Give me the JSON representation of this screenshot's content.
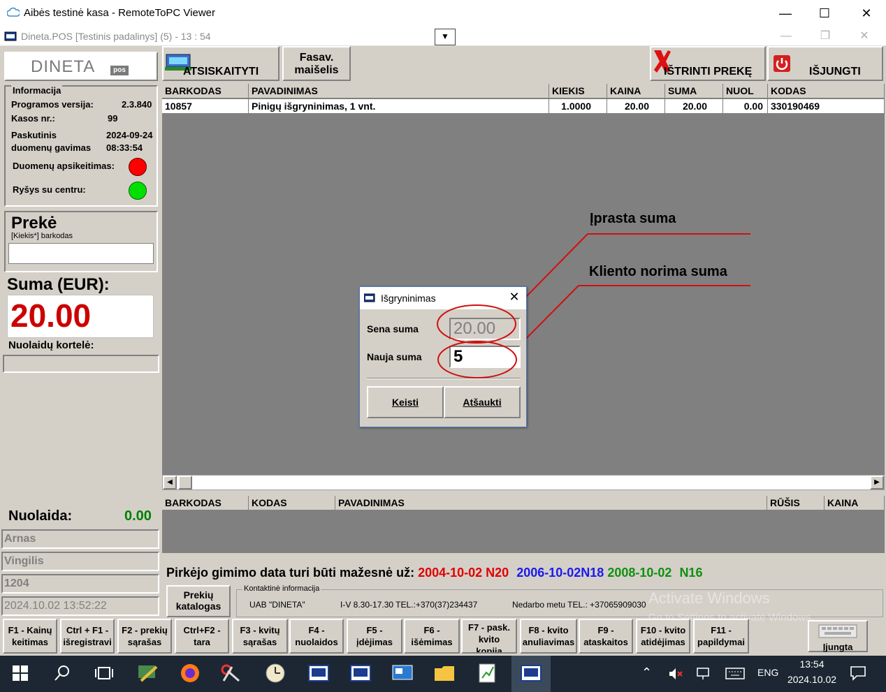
{
  "window": {
    "title": "Aibės testinė kasa - RemoteToPC Viewer"
  },
  "app": {
    "title": "Dineta.POS [Testinis padalinys] (5) - 13 : 54"
  },
  "toolbar": {
    "pay": "ATSISKAITYTI",
    "bag_line1": "Fasav.",
    "bag_line2": "maišelis",
    "delete": "IŠTRINTI PREKĘ",
    "off": "IŠJUNGTI"
  },
  "sidebar": {
    "logo": "DINETA",
    "logo_sub": "pos",
    "info_title": "Informacija",
    "version_label": "Programos versija:",
    "version_value": "2.3.840",
    "till_label": "Kasos nr.:",
    "till_value": "99",
    "last_label1": "Paskutinis",
    "last_label2": "duomenų gavimas",
    "last_date": "2024-09-24",
    "last_time": "08:33:54",
    "exchange_label": "Duomenų apsikeitimas:",
    "exchange_color": "#ff0000",
    "center_label": "Ryšys su centru:",
    "center_color": "#00e000",
    "item_title": "Prekė",
    "item_hint": "[Kiekis*] barkodas",
    "item_input": "",
    "sum_title": "Suma (EUR):",
    "sum_value": "20.00",
    "card_label": "Nuolaidų kortelė:",
    "card_value": "",
    "discount_label": "Nuolaida:",
    "discount_value": "0.00",
    "field1": "Arnas",
    "field2": "Vingilis",
    "field3": "1204",
    "field4": "2024.10.02 13:52:22"
  },
  "grid": {
    "columns": [
      "BARKODAS",
      "PAVADINIMAS",
      "KIEKIS",
      "KAINA",
      "SUMA",
      "NUOL",
      "KODAS"
    ],
    "rows": [
      [
        "10857",
        "Pinigų išgryninimas, 1 vnt.",
        "1.0000",
        "20.00",
        "20.00",
        "0.00",
        "330190469"
      ]
    ]
  },
  "grid2": {
    "columns": [
      "BARKODAS",
      "KODAS",
      "PAVADINIMAS",
      "RŪŠIS",
      "KAINA"
    ]
  },
  "annotations": {
    "usual": "Įprasta suma",
    "client": "Kliento norima suma"
  },
  "dialog": {
    "title": "Išgryninimas",
    "old_label": "Sena suma",
    "old_value": "20.00",
    "new_label": "Nauja suma",
    "new_value": "5",
    "change_btn": "Keisti",
    "cancel_btn": "Atšaukti"
  },
  "birth": {
    "text": "Pirkėjo gimimo data turi būti mažesnė už:",
    "d1": "2004-10-02",
    "n1": "N20",
    "d2": "2006-10-02",
    "n2": "N18",
    "d3": "2008-10-02",
    "n3": "N16"
  },
  "catalog": {
    "line1": "Prekių",
    "line2": "katalogas"
  },
  "contact": {
    "legend": "Kontaktinė informacija",
    "company": "UAB \"DINETA\"",
    "hours": "I-V 8.30-17.30 TEL.:+370(37)234437",
    "off_hours": "Nedarbo metu TEL.: +37065909030"
  },
  "watermark": {
    "line1": "Activate Windows",
    "line2": "Go to Settings to activate Windows."
  },
  "fkeys": [
    [
      "F1 - Kainų",
      "keitimas"
    ],
    [
      "Ctrl + F1 -",
      "išregistravi"
    ],
    [
      "F2 - prekių",
      "sąrašas"
    ],
    [
      "Ctrl+F2 -",
      "tara"
    ],
    [
      "F3 - kvitų",
      "sąrašas"
    ],
    [
      "F4 -",
      "nuolaidos"
    ],
    [
      "F5 -",
      "įdėjimas"
    ],
    [
      "F6 -",
      "išėmimas"
    ],
    [
      "F7 - pask. kvito",
      "kopija"
    ],
    [
      "F8 - kvito",
      "anuliavimas"
    ],
    [
      "F9 -",
      "ataskaitos"
    ],
    [
      "F10 - kvito",
      "atidėjimas"
    ],
    [
      "F11 -",
      "papildymai"
    ]
  ],
  "keyboard": {
    "label": "Įjungta"
  },
  "taskbar": {
    "lang": "ENG",
    "time": "13:54",
    "date": "2024.10.02"
  }
}
